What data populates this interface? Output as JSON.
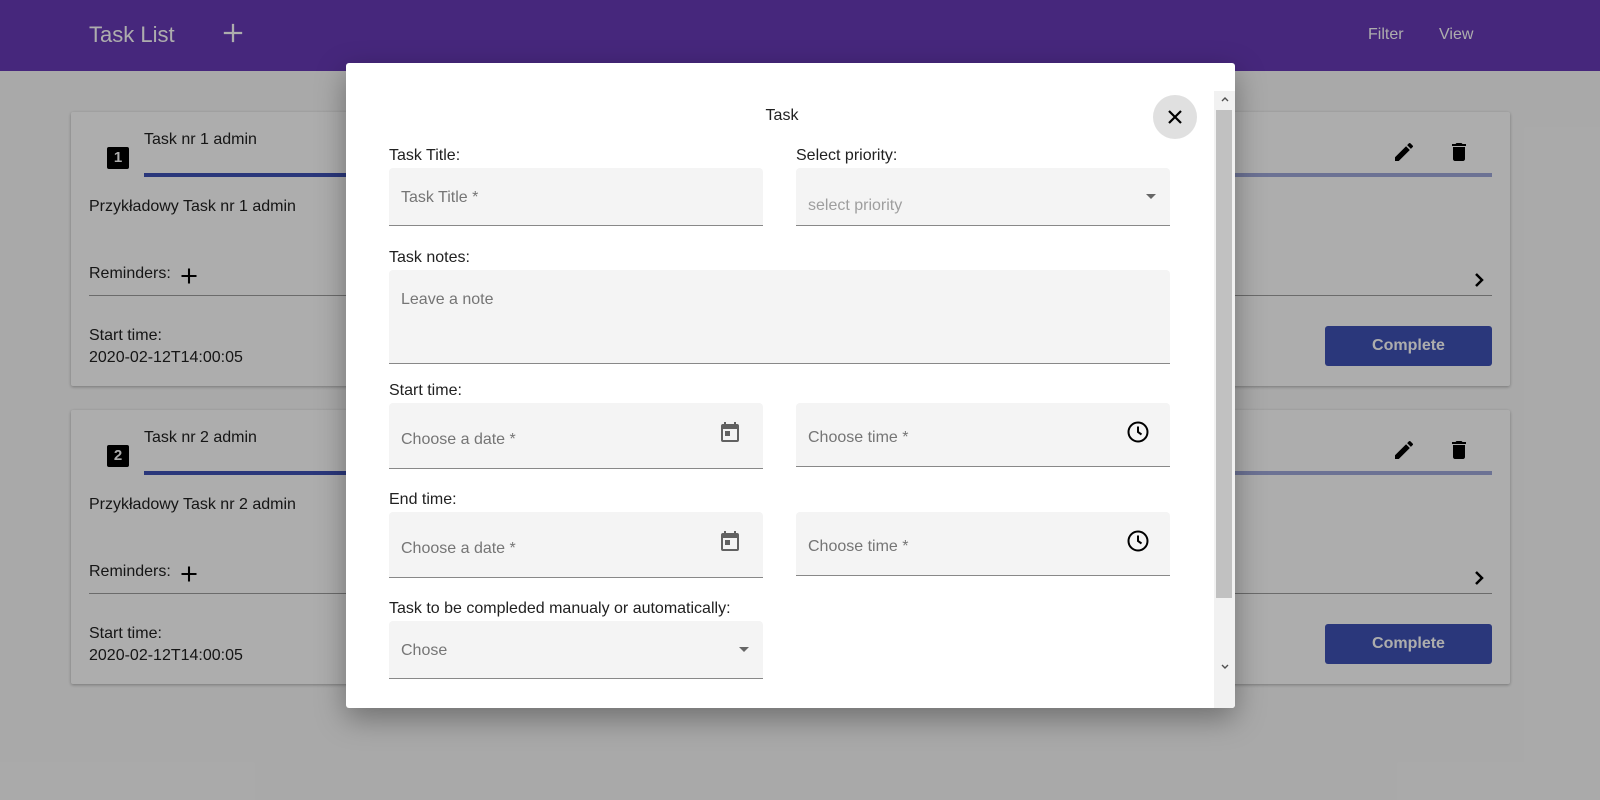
{
  "app": {
    "title": "Task List",
    "nav": {
      "filter": "Filter",
      "view": "View"
    }
  },
  "tasks": [
    {
      "number": "1",
      "title": "Task nr 1 admin",
      "description": "Przykładowy Task nr 1 admin",
      "reminders_label": "Reminders:",
      "start_label": "Start time:",
      "start_value": "2020-02-12T14:00:05",
      "complete_label": "Complete"
    },
    {
      "number": "2",
      "title": "Task nr 2 admin",
      "description": "Przykładowy Task nr 2 admin",
      "reminders_label": "Reminders:",
      "start_label": "Start time:",
      "start_value": "2020-02-12T14:00:05",
      "complete_label": "Complete"
    }
  ],
  "dialog": {
    "title": "Task",
    "task_title_label": "Task Title:",
    "task_title_placeholder": "Task Title *",
    "priority_label": "Select priority:",
    "priority_placeholder": "select priority",
    "notes_label": "Task notes:",
    "notes_placeholder": "Leave a note",
    "start_label": "Start time:",
    "start_date_placeholder": "Choose a date *",
    "start_time_placeholder": "Choose time *",
    "end_label": "End time:",
    "end_date_placeholder": "Choose a date *",
    "end_time_placeholder": "Choose time *",
    "mode_label": "Task to be compleded manualy or automatically:",
    "mode_placeholder": "Chose"
  },
  "colors": {
    "primary": "#673ab7",
    "accent": "#3f51b5",
    "progress_track": "#9fa8da"
  },
  "icons": [
    "add-icon",
    "edit-icon",
    "delete-icon",
    "chevron-right-icon",
    "close-icon",
    "calendar-icon",
    "clock-icon",
    "dropdown-caret-icon"
  ]
}
